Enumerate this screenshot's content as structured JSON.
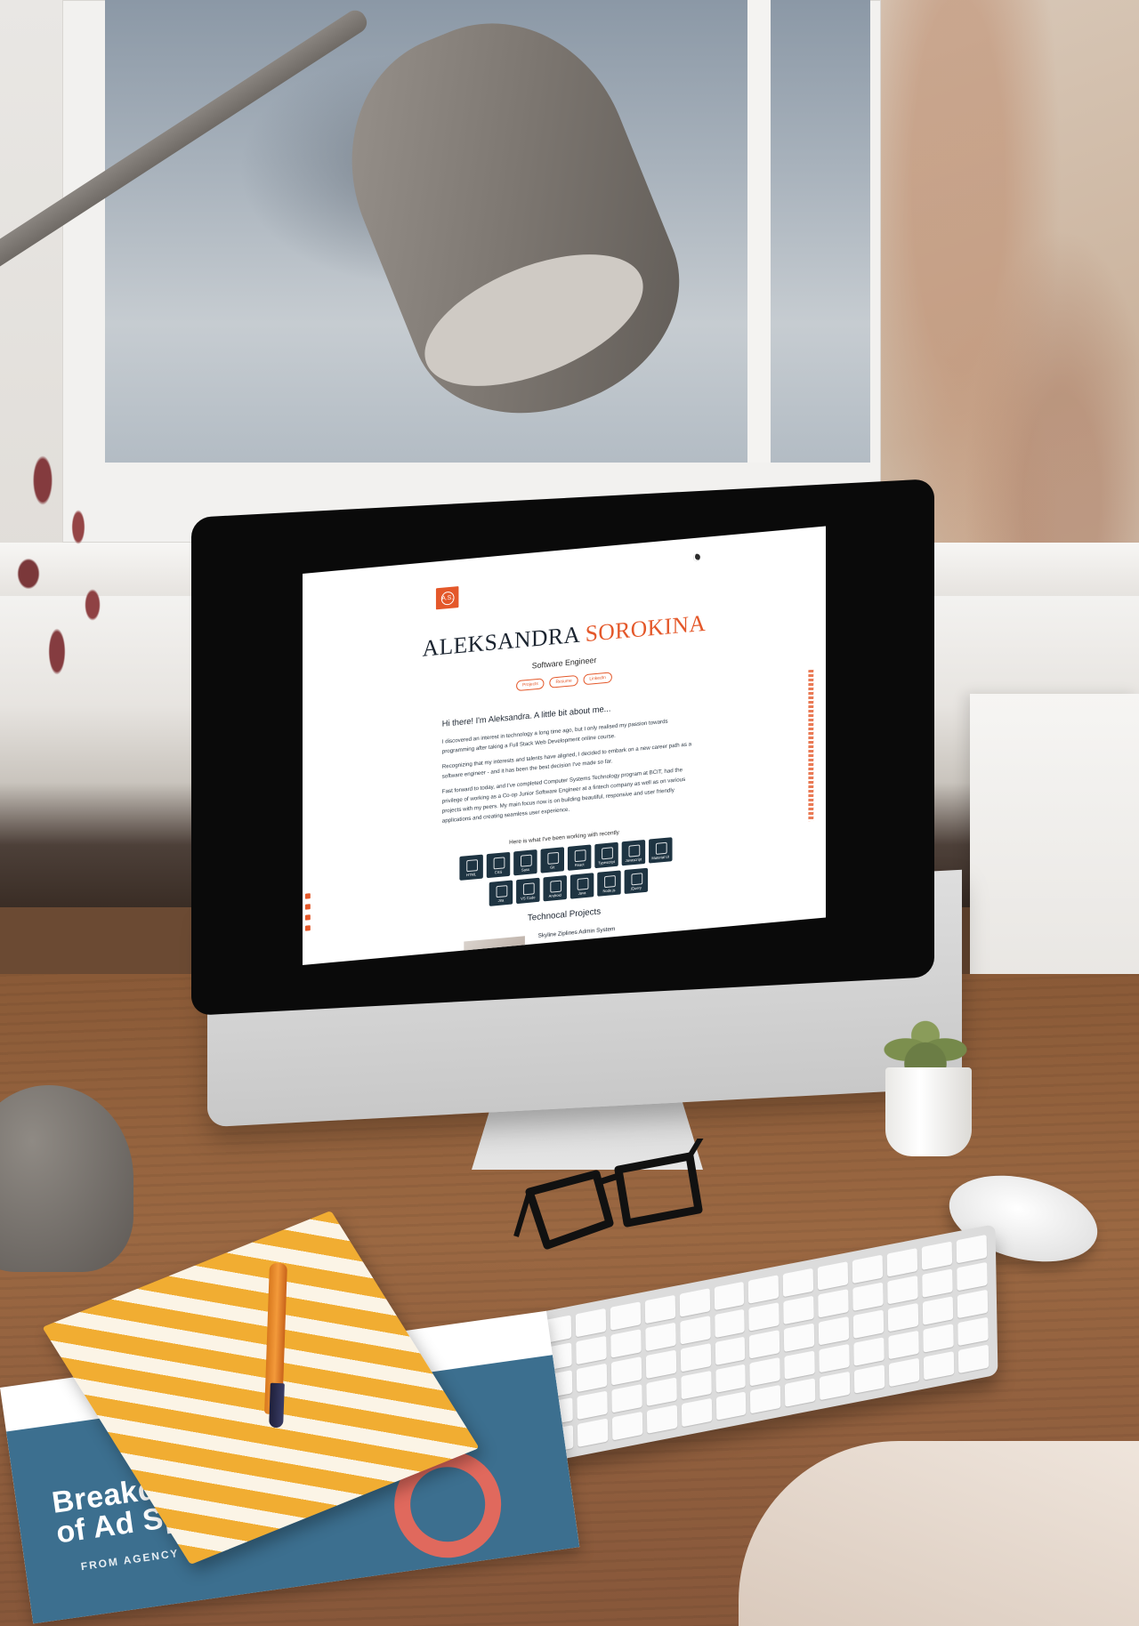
{
  "site": {
    "logo_text": "A.S.",
    "first_name": "Aleksandra",
    "last_name": "Sorokina",
    "role": "Software Engineer",
    "nav": [
      "Projects",
      "Resume",
      "LinkedIn"
    ],
    "intro_title": "Hi there! I'm Aleksandra. A little bit about me...",
    "paragraphs": [
      "I discovered an interest in technology a long time ago, but I only realised my passion towards programming after taking a Full Stack Web Development online course.",
      "Recognizing that my interests and talents have aligned, I decided to embark on a new career path as a software engineer - and it has been the best decision I've made so far.",
      "Fast forward to today, and I've completed Computer Systems Technology program at BCIT, had the privilege of working as a Co-op Junior Software Engineer at a fintech company as well as on various projects with my peers. My main focus now is on building beautiful, responsive and user friendly applications and creating seamless user experience."
    ],
    "skills_caption": "Here is what I've been working with recently",
    "skills_row1": [
      "HTML",
      "CSS",
      "Sass",
      "Git",
      "React",
      "Typescript",
      "Javascript",
      "Material UI"
    ],
    "skills_row2": [
      "Jira",
      "VS Code",
      "Android",
      "Java",
      "Node.js",
      "jQuery"
    ],
    "projects_title": "Technocal Projects",
    "project_name": "Skyline Ziplines Admin System",
    "accent_color": "#e4582a",
    "tile_color": "#1e3442"
  },
  "report": {
    "title_line1": "Breakdow",
    "title_line2": "of Ad Spen",
    "subtitle": "FROM AGENCY REPOR"
  }
}
